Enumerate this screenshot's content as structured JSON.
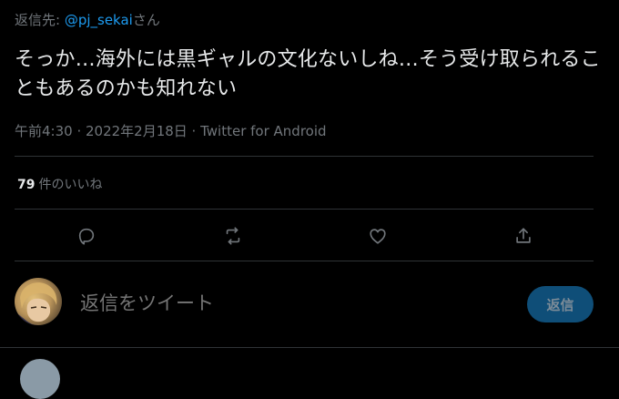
{
  "reply_context": {
    "prefix": "返信先: ",
    "handle": "@pj_sekai",
    "suffix": "さん"
  },
  "tweet": {
    "text": "そっか…海外には黒ギャルの文化ないしね…そう受け取られることもあるのかも知れない",
    "timestamp": "午前4:30 · 2022年2月18日 · Twitter for Android"
  },
  "stats": {
    "likes_count": "79",
    "likes_label": "件のいいね"
  },
  "actions": [
    {
      "name": "reply",
      "icon": "reply-icon"
    },
    {
      "name": "retweet",
      "icon": "retweet-icon"
    },
    {
      "name": "like",
      "icon": "heart-icon"
    },
    {
      "name": "share",
      "icon": "share-icon"
    }
  ],
  "reply_box": {
    "placeholder": "返信をツイート",
    "button_label": "返信"
  },
  "colors": {
    "background": "#000000",
    "text": "#e7e9ea",
    "secondary_text": "#71767b",
    "link": "#1d9bf0",
    "divider": "#2f3336",
    "reply_button_disabled": "#0f4e78"
  }
}
